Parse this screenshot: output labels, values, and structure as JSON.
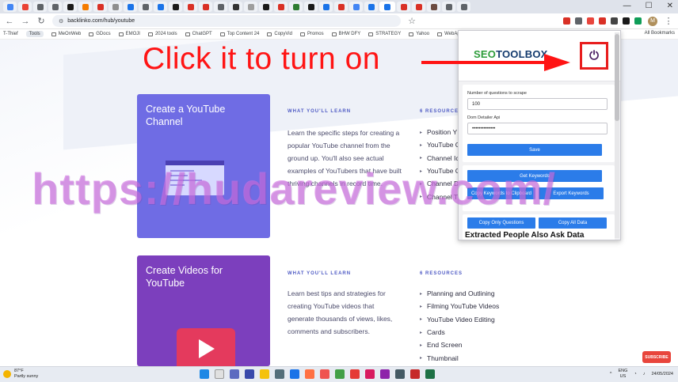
{
  "browser": {
    "url": "backlinko.com/hub/youtube",
    "tab_favicon_colors": [
      "#4285f4",
      "#ea4335",
      "#5f6368",
      "#5f6368",
      "#1a1a1a",
      "#f57c00",
      "#d93025",
      "#8e8e8e",
      "#1a73e8",
      "#5f6368",
      "#1a73e8",
      "#1a1a1a",
      "#d93025",
      "#d93025",
      "#5f6368",
      "#333333",
      "#9e9e9e",
      "#1a1a1a",
      "#d93025",
      "#2e7d32",
      "#1a1a1a",
      "#1a73e8",
      "#d93025",
      "#4285f4",
      "#1a73e8",
      "#1a73e8",
      "#d93025",
      "#d93025",
      "#6d4c41",
      "#5f6368",
      "#5f6368"
    ],
    "extension_colors": [
      "#d93025",
      "#5f6368",
      "#e8453c",
      "#d93025",
      "#444444",
      "#1a1a1a",
      "#0f9d58"
    ],
    "avatar_letter": "M",
    "bookmarks": [
      "T-Thief",
      "Tools",
      "MeOnWeb",
      "GDocs",
      "EMOJI",
      "2024 tools",
      "ChatGPT",
      "Top Content 24",
      "CopyVid",
      "Promos",
      "BHW DFY",
      "STRATEGY",
      "Yahoo",
      "WebApps",
      "WHM"
    ],
    "all_bookmarks_label": "All Bookmarks"
  },
  "page": {
    "courses": [
      {
        "title": "Create a YouTube Channel",
        "learn_heading": "WHAT YOU'LL LEARN",
        "learn_text": "Learn the specific steps for creating a popular YouTube channel from the ground up. You'll also see actual examples of YouTubers that have built thriving channels in record time.",
        "resources_heading": "6 RESOURCES",
        "resources": [
          "Position Y",
          "YouTube C",
          "Channel Ic",
          "YouTube C",
          "Channel D",
          "Channel T"
        ]
      },
      {
        "title": "Create Videos for YouTube",
        "learn_heading": "WHAT YOU'LL LEARN",
        "learn_text": "Learn best tips and strategies for creating YouTube videos that generate thousands of views, likes, comments and subscribers.",
        "resources_heading": "6 RESOURCES",
        "resources": [
          "Planning and Outlining",
          "Filming YouTube Videos",
          "YouTube Video Editing",
          "Cards",
          "End Screen",
          "Thumbnail"
        ]
      }
    ]
  },
  "extension": {
    "logo_seo": "SE",
    "logo_o": "O",
    "logo_rest": "TOOLBOX",
    "questions_label": "Number of questions to scrape",
    "questions_value": "100",
    "api_label": "Dom Detailer Api",
    "api_value": "••••••••••••••",
    "save_label": "Save",
    "get_keywords_label": "Get Keywords",
    "copy_keywords_label": "Copy Keywords to Clipboard",
    "export_keywords_label": "Export Keywords",
    "copy_questions_label": "Copy Only Questions",
    "copy_all_label": "Copy All Data",
    "extracted_title": "Extracted People Also Ask Data"
  },
  "annotation": {
    "instruction": "Click it to turn on",
    "watermark": "https://hudareview.com/",
    "accent_color": "#ff1414"
  },
  "taskbar": {
    "temperature": "87°F",
    "weather": "Partly sunny",
    "lang_line1": "ENG",
    "lang_line2": "US",
    "time": "",
    "date": "24/05/2024",
    "subscribe_label": "SUBSCRIBE"
  }
}
